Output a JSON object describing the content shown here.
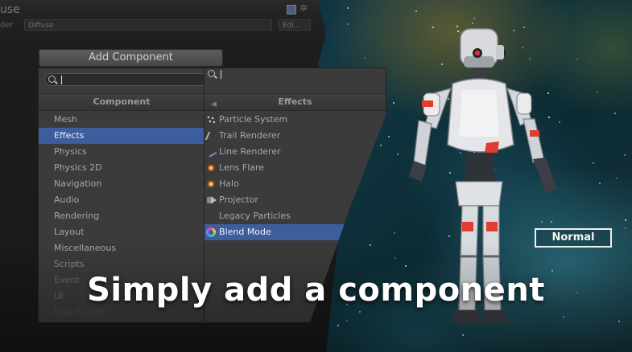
{
  "inspector": {
    "title_fragment": "use",
    "shader_label_fragment": "der",
    "shader_value": "Diffuse",
    "edit_button": "Edi..."
  },
  "add_component_button": "Add Component",
  "component_panel": {
    "header": "Component",
    "search_placeholder": "",
    "items": [
      "Mesh",
      "Effects",
      "Physics",
      "Physics 2D",
      "Navigation",
      "Audio",
      "Rendering",
      "Layout",
      "Miscellaneous",
      "Scripts",
      "Event",
      "UI",
      "New Script"
    ],
    "selected_item": "Effects"
  },
  "effects_panel": {
    "header": "Effects",
    "items": [
      {
        "label": "Particle System",
        "icon": "particle-system-icon"
      },
      {
        "label": "Trail Renderer",
        "icon": "trail-renderer-icon"
      },
      {
        "label": "Line Renderer",
        "icon": "line-renderer-icon"
      },
      {
        "label": "Lens Flare",
        "icon": "lens-flare-icon"
      },
      {
        "label": "Halo",
        "icon": "halo-icon"
      },
      {
        "label": "Projector",
        "icon": "projector-icon"
      },
      {
        "label": "Legacy Particles",
        "icon": ""
      },
      {
        "label": "Blend Mode",
        "icon": "blend-mode-icon"
      }
    ],
    "selected_item": "Blend Mode"
  },
  "mode_badge": "Normal",
  "headline": "Simply add a component",
  "colors": {
    "selection": "#3d5d9c",
    "panel_bg": "#3b3b3b",
    "headline": "#ffffff"
  }
}
